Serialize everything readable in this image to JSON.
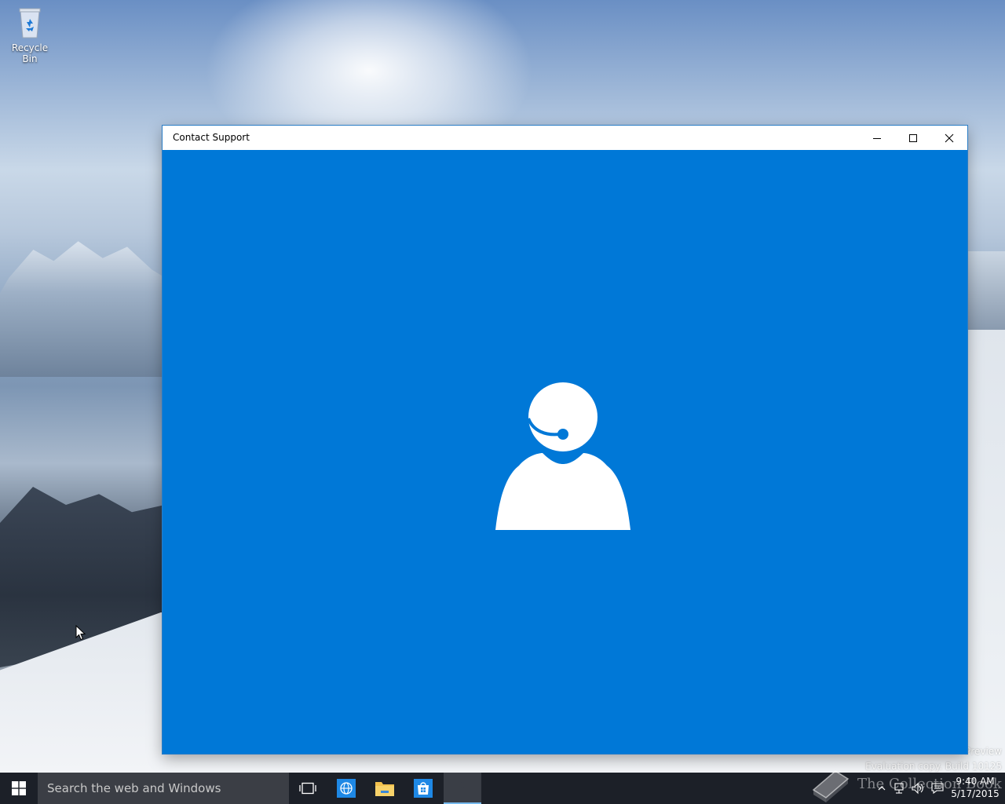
{
  "desktop": {
    "icons": [
      {
        "label": "Recycle Bin",
        "icon": "recycle-bin-icon"
      }
    ]
  },
  "window": {
    "title": "Contact Support",
    "accent_color": "#0078d7",
    "hero_icon": "support-agent-headset-icon",
    "controls": {
      "minimize_icon": "minimize-icon",
      "maximize_icon": "maximize-icon",
      "close_icon": "close-icon"
    }
  },
  "watermark": {
    "line1": "Preview",
    "line2": "Evaluation copy. Build 10125"
  },
  "taskbar": {
    "background": "#1c2028",
    "start_icon": "windows-logo-icon",
    "search_placeholder": "Search the web and Windows",
    "pinned": [
      {
        "name": "task-view",
        "icon": "task-view-icon"
      },
      {
        "name": "internet-explorer",
        "icon": "globe-icon"
      },
      {
        "name": "file-explorer",
        "icon": "folder-icon"
      },
      {
        "name": "store",
        "icon": "store-bag-icon"
      },
      {
        "name": "contact-support",
        "icon": "support-icon",
        "active": true
      }
    ],
    "overlay_brand_text": "The Collection Book",
    "tray": {
      "icons": [
        "chevron-up-icon",
        "network-icon",
        "volume-icon",
        "action-center-icon"
      ],
      "time": "9:40 AM",
      "date": "5/17/2015"
    }
  }
}
